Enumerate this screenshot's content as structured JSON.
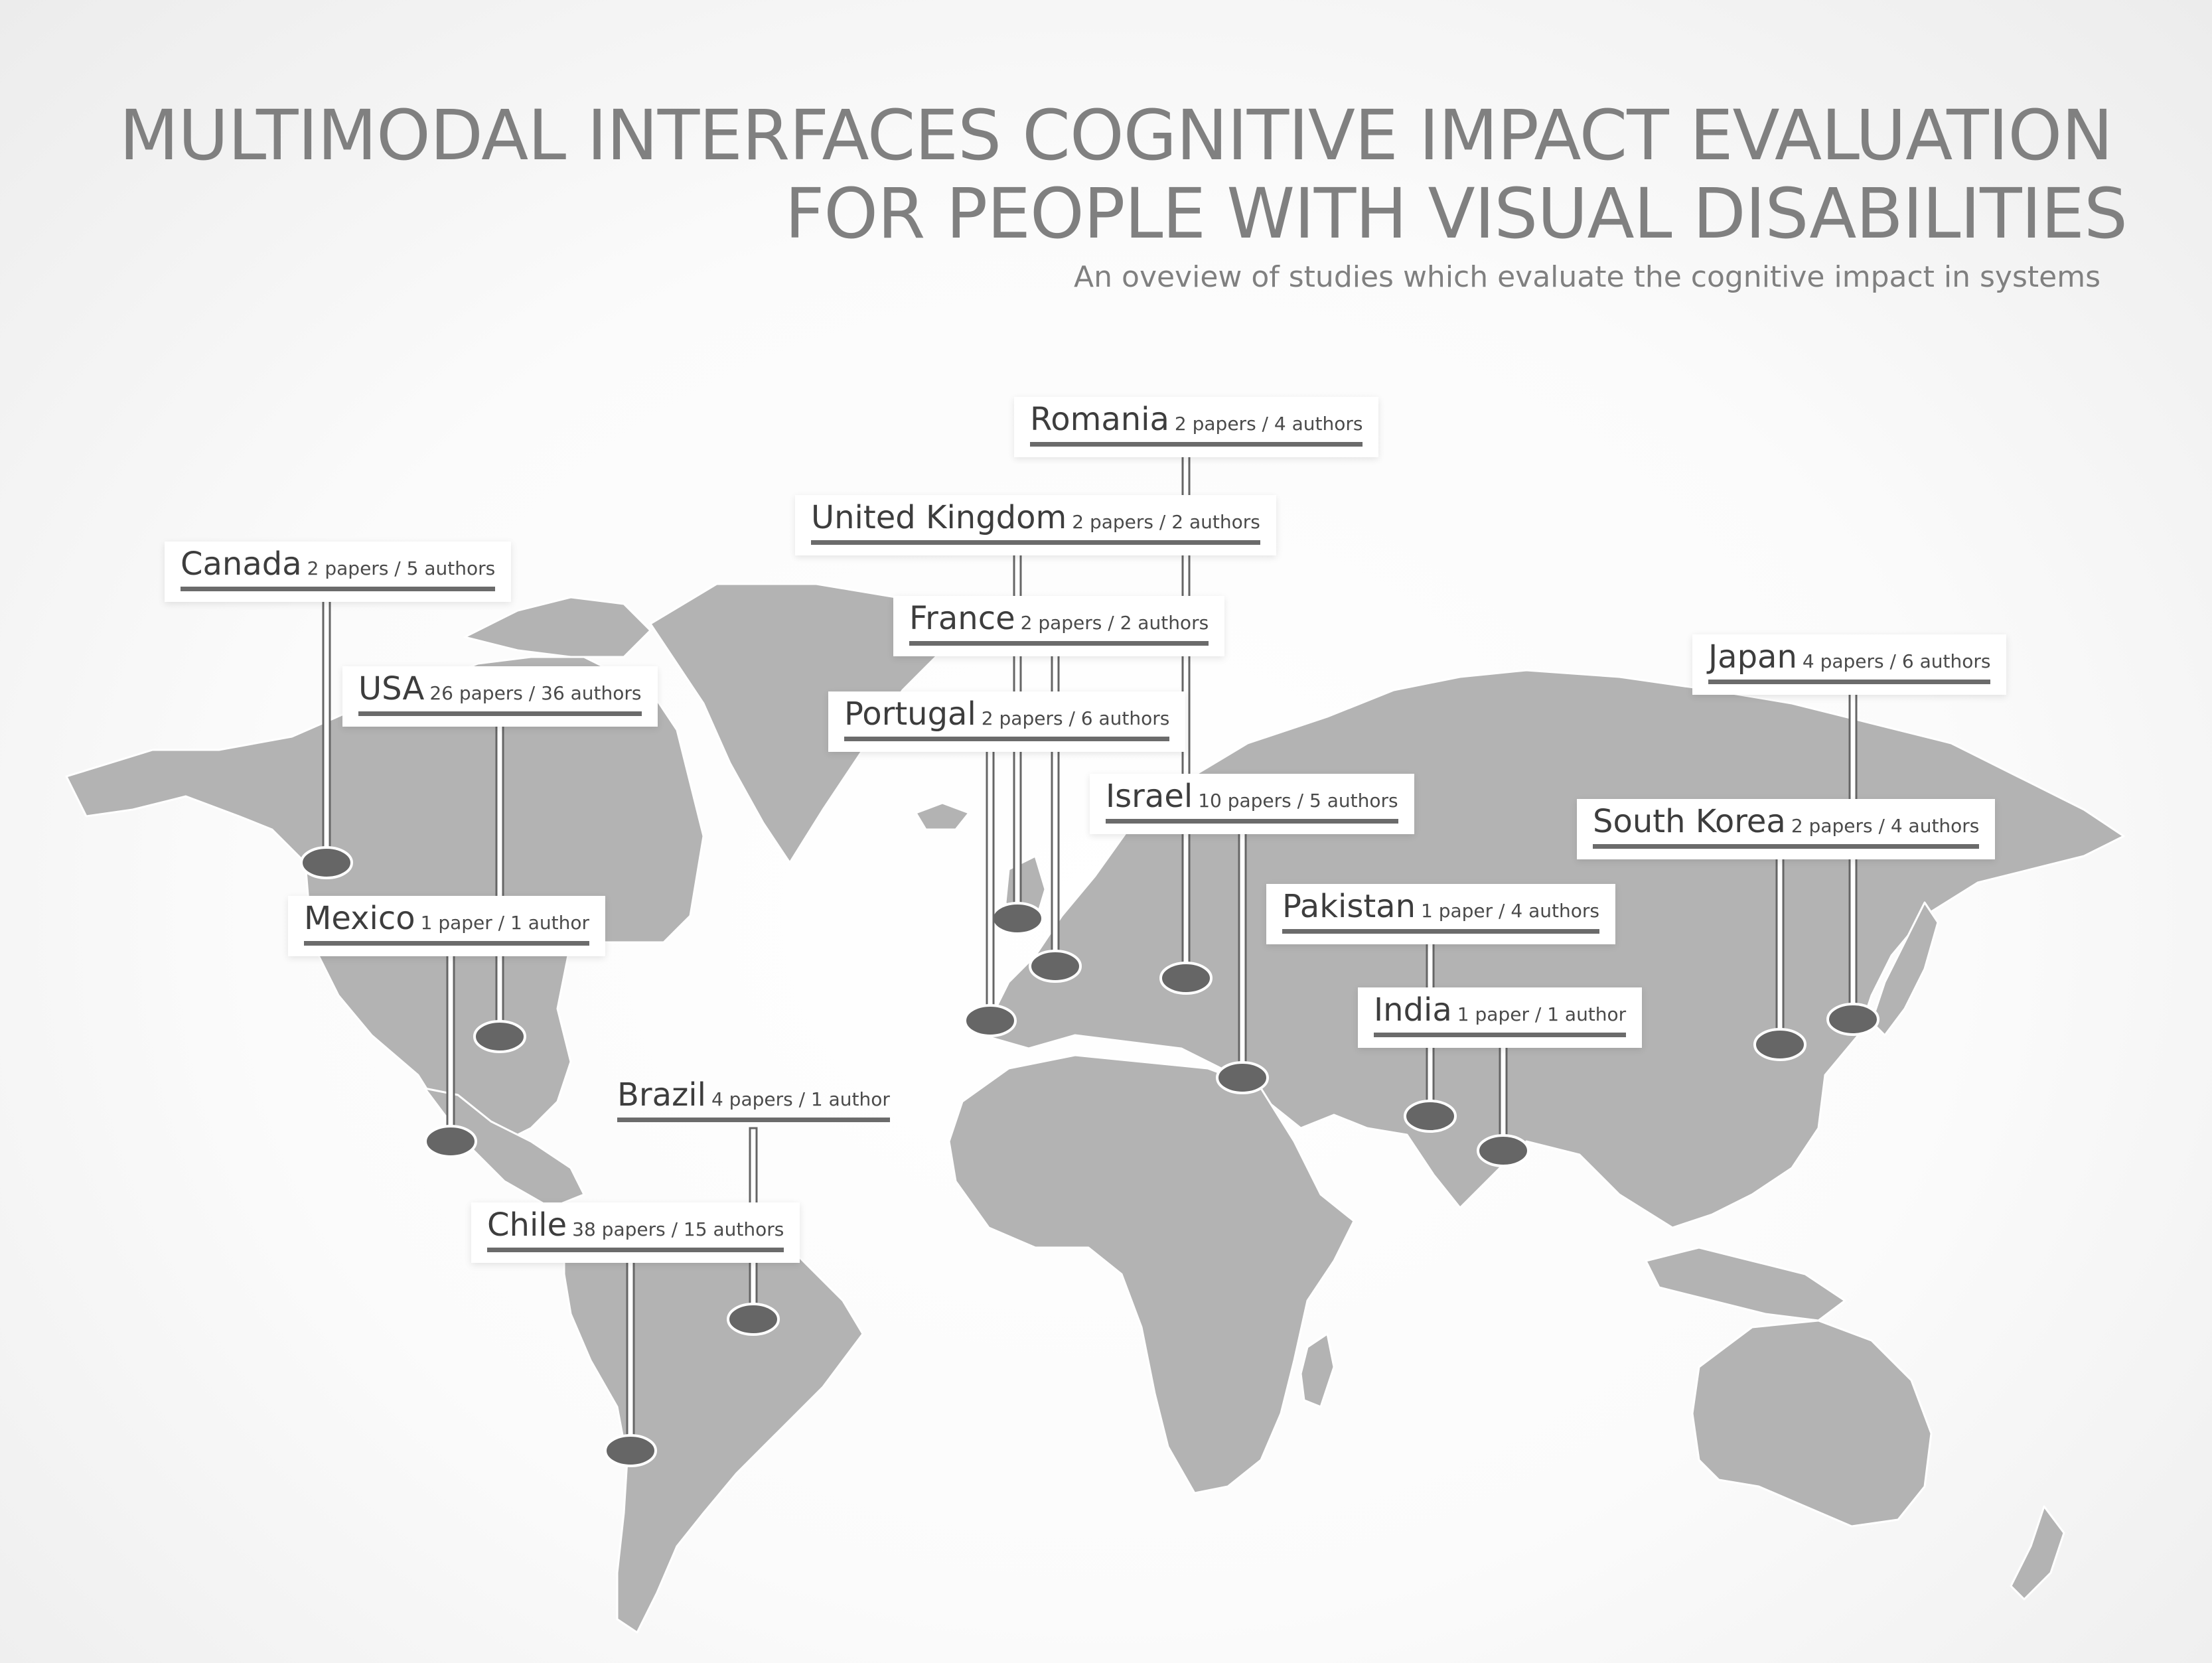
{
  "title": {
    "line1": "MULTIMODAL INTERFACES COGNITIVE IMPACT EVALUATION",
    "line2": "FOR PEOPLE WITH VISUAL DISABILITIES"
  },
  "subtitle": "An oveview of studies which evaluate the cognitive impact in systems",
  "colors": {
    "land": "#b3b3b3",
    "land_border": "#ffffff",
    "pin": "#666666",
    "label_line": "#6b6b6b",
    "title": "#808080"
  },
  "countries": [
    {
      "id": "romania",
      "name": "Romania",
      "stats": "2 papers / 4 authors",
      "papers": 2,
      "authors": 4
    },
    {
      "id": "united-kingdom",
      "name": "United Kingdom",
      "stats": "2 papers / 2 authors",
      "papers": 2,
      "authors": 2
    },
    {
      "id": "canada",
      "name": "Canada",
      "stats": "2 papers / 5 authors",
      "papers": 2,
      "authors": 5
    },
    {
      "id": "france",
      "name": "France",
      "stats": "2 papers / 2 authors",
      "papers": 2,
      "authors": 2
    },
    {
      "id": "japan",
      "name": "Japan",
      "stats": "4 papers / 6 authors",
      "papers": 4,
      "authors": 6
    },
    {
      "id": "usa",
      "name": "USA",
      "stats": "26 papers / 36 authors",
      "papers": 26,
      "authors": 36
    },
    {
      "id": "portugal",
      "name": "Portugal",
      "stats": "2 papers / 6 authors",
      "papers": 2,
      "authors": 6
    },
    {
      "id": "israel",
      "name": "Israel",
      "stats": "10 papers / 5 authors",
      "papers": 10,
      "authors": 5
    },
    {
      "id": "south-korea",
      "name": "South Korea",
      "stats": "2 papers / 4 authors",
      "papers": 2,
      "authors": 4
    },
    {
      "id": "mexico",
      "name": "Mexico",
      "stats": "1 paper / 1 author",
      "papers": 1,
      "authors": 1
    },
    {
      "id": "pakistan",
      "name": "Pakistan",
      "stats": "1 paper / 4 authors",
      "papers": 1,
      "authors": 4
    },
    {
      "id": "india",
      "name": "India",
      "stats": "1 paper / 1 author",
      "papers": 1,
      "authors": 1
    },
    {
      "id": "brazil",
      "name": "Brazil",
      "stats": "4 papers / 1 author",
      "papers": 4,
      "authors": 1
    },
    {
      "id": "chile",
      "name": "Chile",
      "stats": "38 papers / 15 authors",
      "papers": 38,
      "authors": 15
    }
  ]
}
